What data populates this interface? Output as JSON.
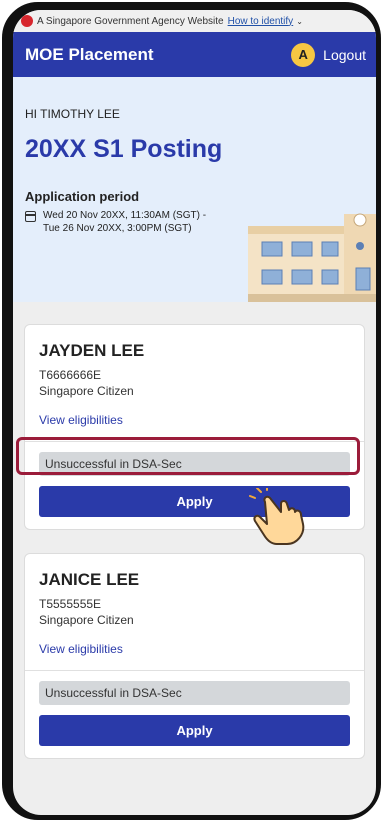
{
  "gov_banner": {
    "text": "A Singapore Government Agency Website",
    "link": "How to identify"
  },
  "header": {
    "title": "MOE Placement",
    "avatar_initial": "A",
    "logout": "Logout"
  },
  "hero": {
    "greeting": "HI TIMOTHY LEE",
    "title": "20XX S1 Posting",
    "period_label": "Application period",
    "period_line1": "Wed 20 Nov 20XX, 11:30AM (SGT) -",
    "period_line2": "Tue 26 Nov 20XX, 3:00PM (SGT)"
  },
  "children": [
    {
      "name": "JAYDEN LEE",
      "nric": "T6666666E",
      "citizenship": "Singapore Citizen",
      "eligibility_link": "View eligibilities",
      "status": "Unsuccessful in DSA-Sec",
      "apply_label": "Apply"
    },
    {
      "name": "JANICE LEE",
      "nric": "T5555555E",
      "citizenship": "Singapore Citizen",
      "eligibility_link": "View eligibilities",
      "status": "Unsuccessful in DSA-Sec",
      "apply_label": "Apply"
    }
  ],
  "colors": {
    "primary": "#2a3aa9",
    "highlight": "#9b1c3a",
    "hero_bg": "#e4eefb"
  }
}
